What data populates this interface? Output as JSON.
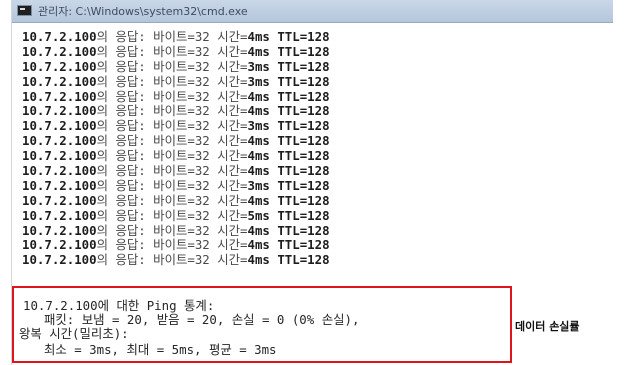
{
  "window": {
    "title": "관리자: C:\\Windows\\system32\\cmd.exe",
    "icon": "cmd-icon"
  },
  "ping_replies": [
    {
      "ip": "10.7.2.100",
      "suffix": "의 응답: 바이트=32 시간=",
      "time": "4ms",
      "ttl": "TTL=128"
    },
    {
      "ip": "10.7.2.100",
      "suffix": "의 응답: 바이트=32 시간=",
      "time": "4ms",
      "ttl": "TTL=128"
    },
    {
      "ip": "10.7.2.100",
      "suffix": "의 응답: 바이트=32 시간=",
      "time": "3ms",
      "ttl": "TTL=128"
    },
    {
      "ip": "10.7.2.100",
      "suffix": "의 응답: 바이트=32 시간=",
      "time": "3ms",
      "ttl": "TTL=128"
    },
    {
      "ip": "10.7.2.100",
      "suffix": "의 응답: 바이트=32 시간=",
      "time": "4ms",
      "ttl": "TTL=128"
    },
    {
      "ip": "10.7.2.100",
      "suffix": "의 응답: 바이트=32 시간=",
      "time": "4ms",
      "ttl": "TTL=128"
    },
    {
      "ip": "10.7.2.100",
      "suffix": "의 응답: 바이트=32 시간=",
      "time": "3ms",
      "ttl": "TTL=128"
    },
    {
      "ip": "10.7.2.100",
      "suffix": "의 응답: 바이트=32 시간=",
      "time": "4ms",
      "ttl": "TTL=128"
    },
    {
      "ip": "10.7.2.100",
      "suffix": "의 응답: 바이트=32 시간=",
      "time": "4ms",
      "ttl": "TTL=128"
    },
    {
      "ip": "10.7.2.100",
      "suffix": "의 응답: 바이트=32 시간=",
      "time": "4ms",
      "ttl": "TTL=128"
    },
    {
      "ip": "10.7.2.100",
      "suffix": "의 응답: 바이트=32 시간=",
      "time": "3ms",
      "ttl": "TTL=128"
    },
    {
      "ip": "10.7.2.100",
      "suffix": "의 응답: 바이트=32 시간=",
      "time": "4ms",
      "ttl": "TTL=128"
    },
    {
      "ip": "10.7.2.100",
      "suffix": "의 응답: 바이트=32 시간=",
      "time": "5ms",
      "ttl": "TTL=128"
    },
    {
      "ip": "10.7.2.100",
      "suffix": "의 응답: 바이트=32 시간=",
      "time": "4ms",
      "ttl": "TTL=128"
    },
    {
      "ip": "10.7.2.100",
      "suffix": "의 응답: 바이트=32 시간=",
      "time": "4ms",
      "ttl": "TTL=128"
    },
    {
      "ip": "10.7.2.100",
      "suffix": "의 응답: 바이트=32 시간=",
      "time": "4ms",
      "ttl": "TTL=128"
    }
  ],
  "statistics": {
    "header": "10.7.2.100에 대한 Ping 통계:",
    "packets": "패킷: 보냄 = 20, 받음 = 20, 손실 = 0 (0% 손실),",
    "rtt_header": "왕복 시간(밀리초):",
    "rtt_values": "최소 = 3ms, 최대 = 5ms, 평균 = 3ms"
  },
  "annotation": {
    "label": "데이터 손실률",
    "box_color": "#e0141b"
  }
}
